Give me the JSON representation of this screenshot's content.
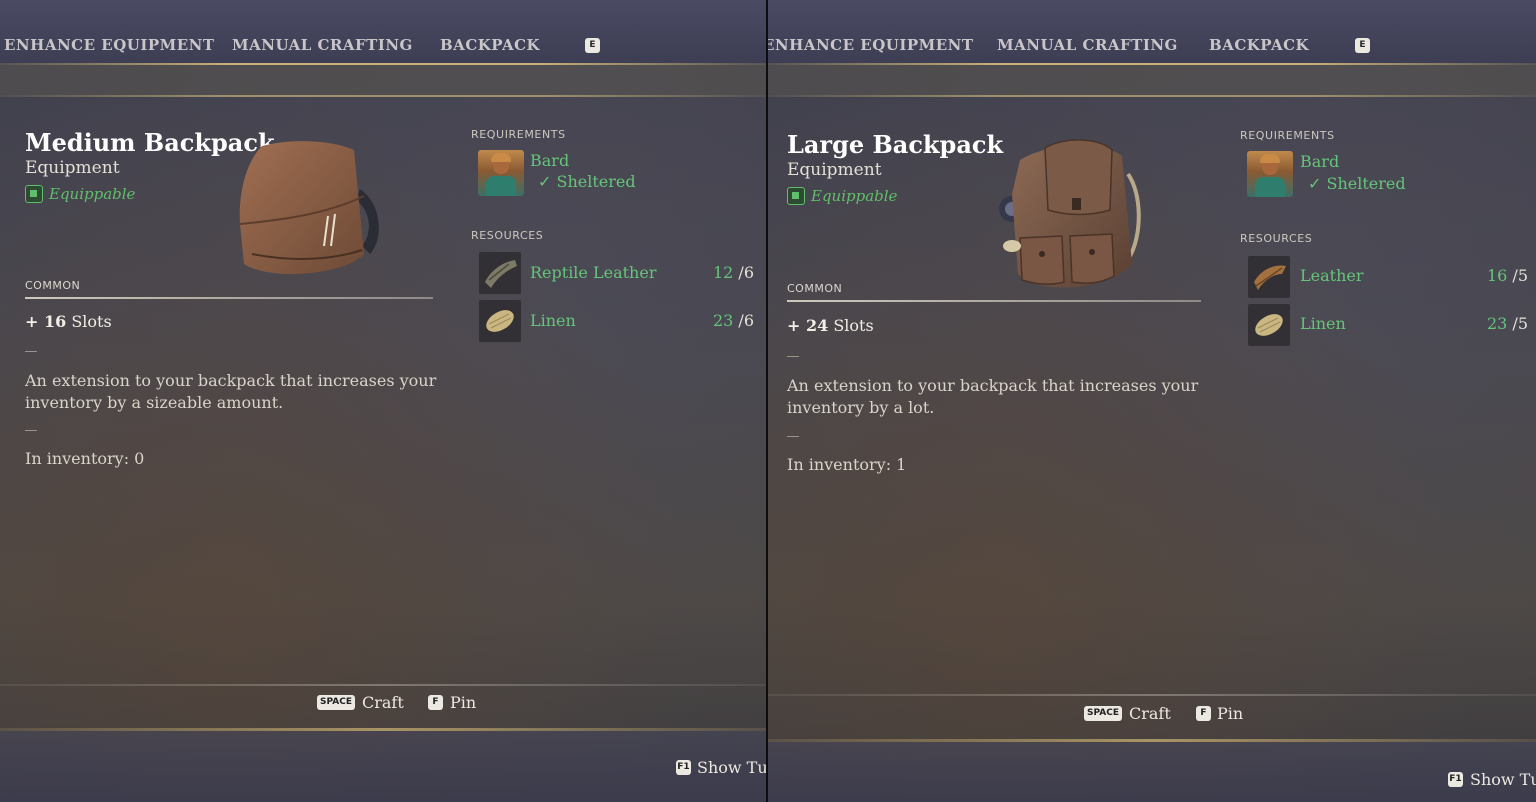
{
  "tabs": {
    "enhance": "ENHANCE EQUIPMENT",
    "manual": "MANUAL CRAFTING",
    "backpack": "BACKPACK",
    "key": "E"
  },
  "labels": {
    "requirements": "REQUIREMENTS",
    "resources": "RESOURCES",
    "slots_word": "Slots"
  },
  "hints": {
    "space_key": "SPACE",
    "craft": "Craft",
    "pin_key": "F",
    "pin": "Pin",
    "f1_key": "F1",
    "show_tutorial": "Show Tu"
  },
  "left": {
    "title": "Medium Backpack",
    "subtitle": "Equipment",
    "equippable": "Equippable",
    "rarity": "COMMON",
    "slots_value": "+ 16",
    "description": "An extension to your backpack that increases your inventory by a sizeable amount.",
    "inventory": "In inventory: 0",
    "requirement": {
      "name": "Bard",
      "condition": "✓ Sheltered"
    },
    "resources": [
      {
        "name": "Reptile Leather",
        "have": "12",
        "need": "6"
      },
      {
        "name": "Linen",
        "have": "23",
        "need": "6"
      }
    ]
  },
  "right": {
    "title": "Large Backpack",
    "subtitle": "Equipment",
    "equippable": "Equippable",
    "rarity": "COMMON",
    "slots_value": "+ 24",
    "description": "An extension to your backpack that increases your inventory by a lot.",
    "inventory": "In inventory: 1",
    "requirement": {
      "name": "Bard",
      "condition": "✓ Sheltered"
    },
    "resources": [
      {
        "name": "Leather",
        "have": "16",
        "need": "5"
      },
      {
        "name": "Linen",
        "have": "23",
        "need": "5"
      }
    ]
  }
}
